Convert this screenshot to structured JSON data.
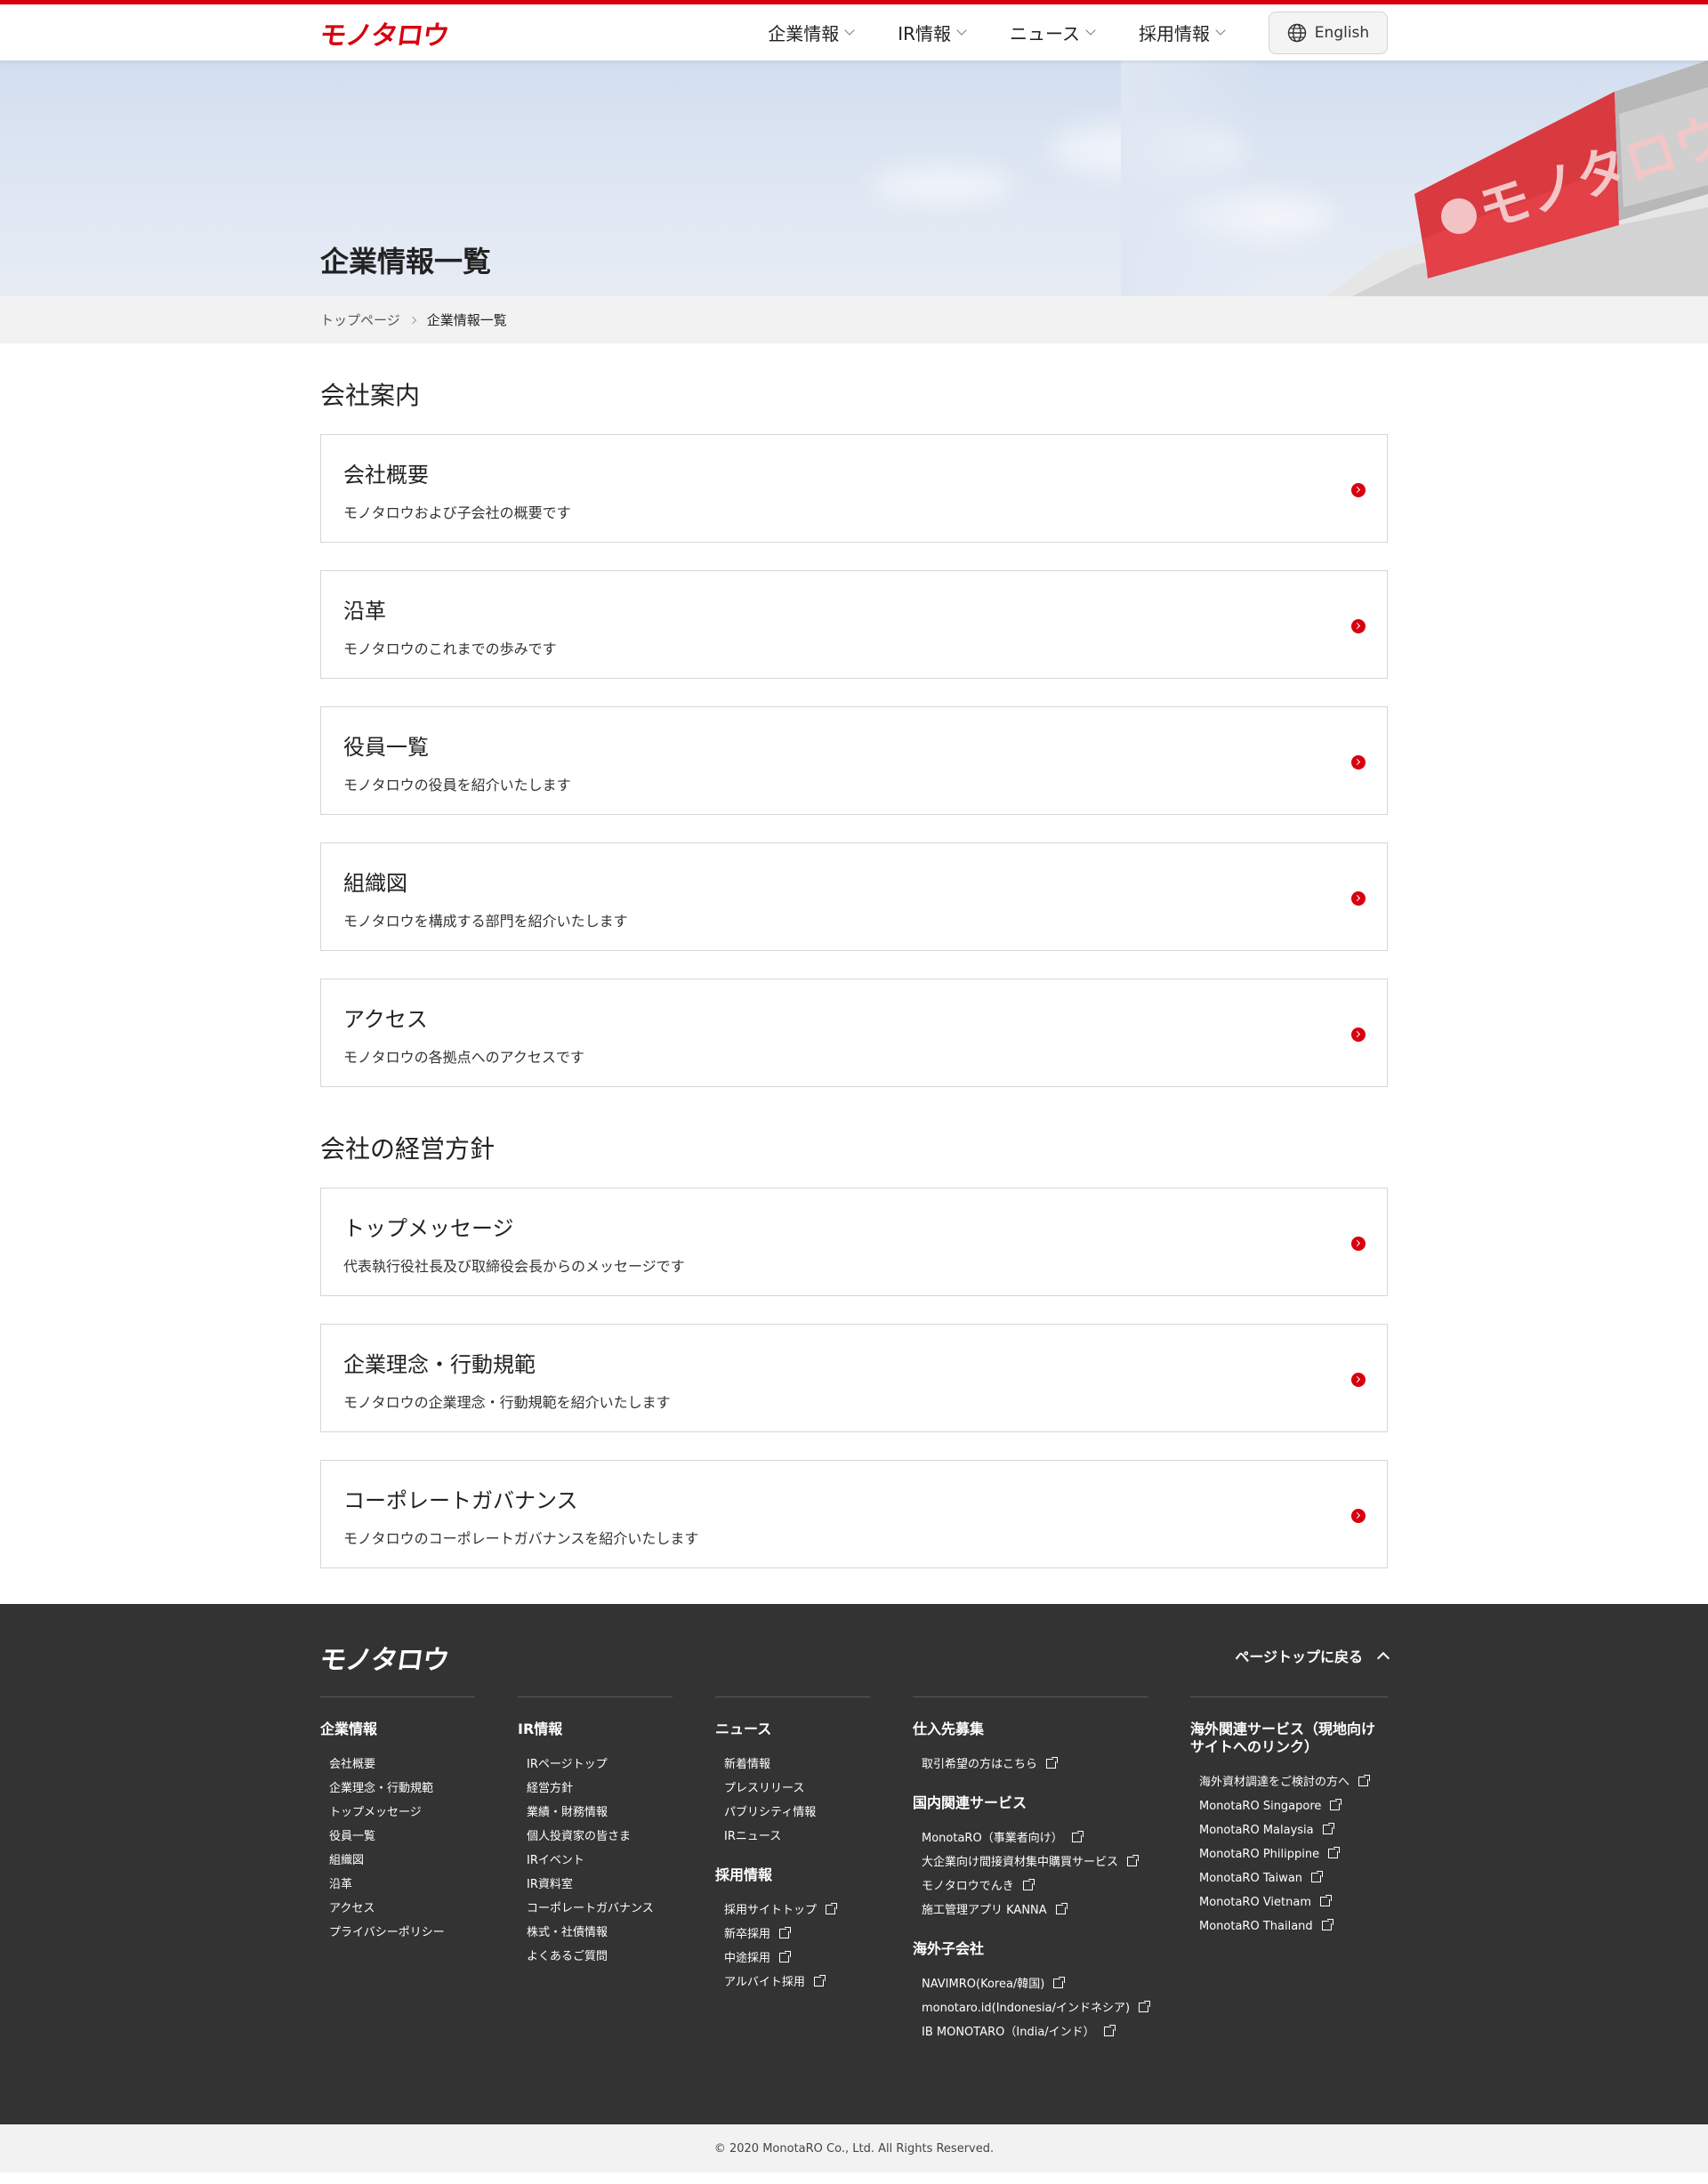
{
  "header": {
    "logo": "モノタロウ",
    "nav": [
      "企業情報",
      "IR情報",
      "ニュース",
      "採用情報"
    ],
    "language": "English"
  },
  "hero": {
    "title": "企業情報一覧"
  },
  "breadcrumb": {
    "home": "トップページ",
    "current": "企業情報一覧"
  },
  "sections": [
    {
      "title": "会社案内",
      "cards": [
        {
          "title": "会社概要",
          "desc": "モノタロウおよび子会社の概要です"
        },
        {
          "title": "沿革",
          "desc": "モノタロウのこれまでの歩みです"
        },
        {
          "title": "役員一覧",
          "desc": "モノタロウの役員を紹介いたします"
        },
        {
          "title": "組織図",
          "desc": "モノタロウを構成する部門を紹介いたします"
        },
        {
          "title": "アクセス",
          "desc": "モノタロウの各拠点へのアクセスです"
        }
      ]
    },
    {
      "title": "会社の経営方針",
      "cards": [
        {
          "title": "トップメッセージ",
          "desc": "代表執行役社長及び取締役会長からのメッセージです"
        },
        {
          "title": "企業理念・行動規範",
          "desc": "モノタロウの企業理念・行動規範を紹介いたします"
        },
        {
          "title": "コーポレートガバナンス",
          "desc": "モノタロウのコーポレートガバナンスを紹介いたします"
        }
      ]
    }
  ],
  "footer": {
    "logo": "モノタロウ",
    "page_top": "ページトップに戻る",
    "columns": {
      "company": {
        "head": "企業情報",
        "items": [
          "会社概要",
          "企業理念・行動規範",
          "トップメッセージ",
          "役員一覧",
          "組織図",
          "沿革",
          "アクセス",
          "プライバシーポリシー"
        ]
      },
      "ir": {
        "head": "IR情報",
        "items": [
          "IRページトップ",
          "経営方針",
          "業績・財務情報",
          "個人投資家の皆さま",
          "IRイベント",
          "IR資料室",
          "コーポレートガバナンス",
          "株式・社債情報",
          "よくあるご質問"
        ]
      },
      "news": {
        "head": "ニュース",
        "items": [
          "新着情報",
          "プレスリリース",
          "パブリシティ情報",
          "IRニュース"
        ]
      },
      "recruit": {
        "head": "採用情報",
        "items": [
          "採用サイトトップ",
          "新卒採用",
          "中途採用",
          "アルバイト採用"
        ]
      },
      "supplier": {
        "head": "仕入先募集",
        "items": [
          "取引希望の方はこちら"
        ]
      },
      "domestic": {
        "head": "国内関連サービス",
        "items": [
          "MonotaRO（事業者向け）",
          "大企業向け間接資材集中購買サービス",
          "モノタロウでんき",
          "施工管理アプリ KANNA"
        ]
      },
      "subsidiaries": {
        "head": "海外子会社",
        "items": [
          "NAVIMRO(Korea/韓国)",
          "monotaro.id(Indonesia/インドネシア)",
          "IB MONOTARO（India/インド）"
        ]
      },
      "overseas": {
        "head": "海外関連サービス（現地向けサイトへのリンク）",
        "items": [
          "海外資材調達をご検討の方へ",
          "MonotaRO Singapore",
          "MonotaRO Malaysia",
          "MonotaRO Philippine",
          "MonotaRO Taiwan",
          "MonotaRO Vietnam",
          "MonotaRO Thailand"
        ]
      }
    },
    "copyright": "© 2020 MonotaRO Co., Ltd. All Rights Reserved."
  },
  "colors": {
    "brand_red": "#d7000f",
    "footer_bg": "#333333",
    "breadcrumb_bg": "#f2f2f2"
  }
}
